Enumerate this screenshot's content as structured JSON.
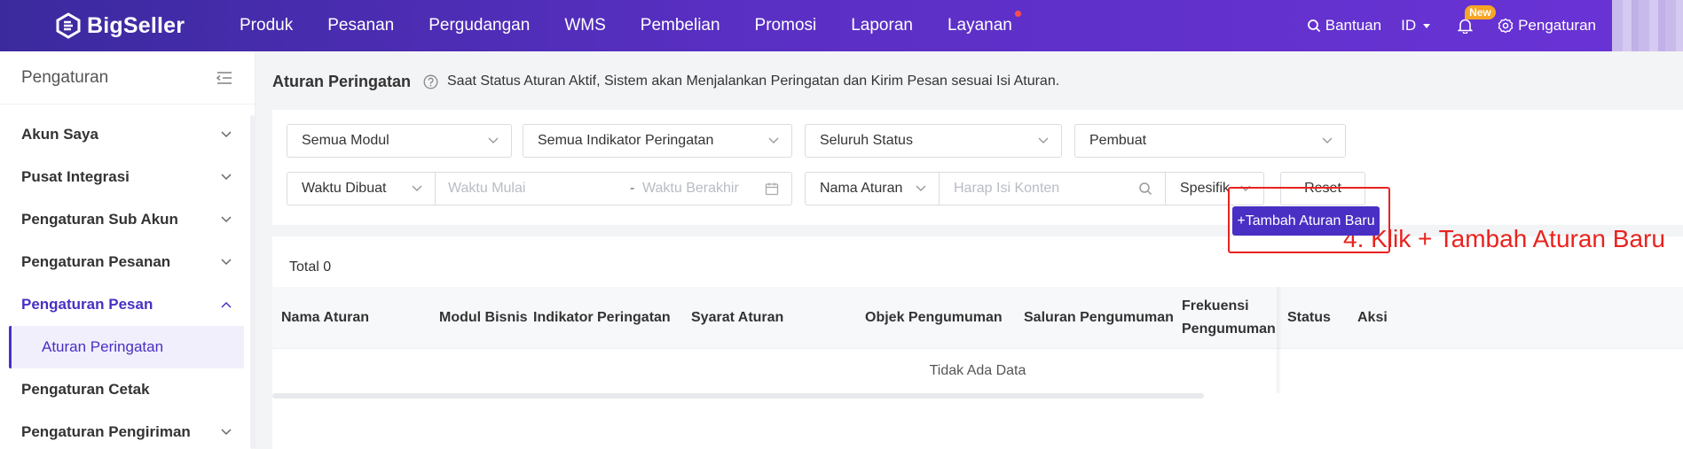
{
  "app": {
    "name": "BigSeller"
  },
  "nav": {
    "items": [
      {
        "label": "Produk"
      },
      {
        "label": "Pesanan"
      },
      {
        "label": "Pergudangan"
      },
      {
        "label": "WMS"
      },
      {
        "label": "Pembelian"
      },
      {
        "label": "Promosi"
      },
      {
        "label": "Laporan"
      },
      {
        "label": "Layanan",
        "has_dot": true
      }
    ],
    "help_label": "Bantuan",
    "language": "ID",
    "new_badge": "New",
    "settings_label": "Pengaturan"
  },
  "sidebar": {
    "title": "Pengaturan",
    "items": [
      {
        "label": "Akun Saya"
      },
      {
        "label": "Pusat Integrasi"
      },
      {
        "label": "Pengaturan Sub Akun"
      },
      {
        "label": "Pengaturan Pesanan"
      },
      {
        "label": "Pengaturan Pesan",
        "expanded": true
      },
      {
        "label": "Pengaturan Cetak"
      },
      {
        "label": "Pengaturan Pengiriman"
      }
    ],
    "active_sub_item": "Aturan Peringatan"
  },
  "page": {
    "title": "Aturan Peringatan",
    "description": "Saat Status Aturan Aktif, Sistem akan Menjalankan Peringatan dan Kirim Pesan sesuai Isi Aturan."
  },
  "filters": {
    "module": "Semua Modul",
    "indicator": "Semua Indikator Peringatan",
    "status": "Seluruh Status",
    "creator": "Pembuat",
    "time_type": "Waktu Dibuat",
    "start_placeholder": "Waktu Mulai",
    "range_separator": "-",
    "end_placeholder": "Waktu Berakhir",
    "search_field": "Nama Aturan",
    "search_placeholder": "Harap Isi Konten",
    "match_mode": "Spesifik",
    "reset_label": "Reset"
  },
  "list": {
    "total": "Total 0",
    "add_button": "+Tambah Aturan Baru",
    "annotation": "4. Klik  + Tambah Aturan Baru",
    "columns": [
      "Nama Aturan",
      "Modul Bisnis",
      "Indikator Peringatan",
      "Syarat Aturan",
      "Objek Pengumuman",
      "Saluran Pengumuman",
      "Frekuensi Pengumuman",
      "Status",
      "Aksi"
    ],
    "empty_text": "Tidak Ada Data"
  },
  "colors": {
    "brand": "#4a2fc4",
    "annotation": "#e8231f"
  }
}
